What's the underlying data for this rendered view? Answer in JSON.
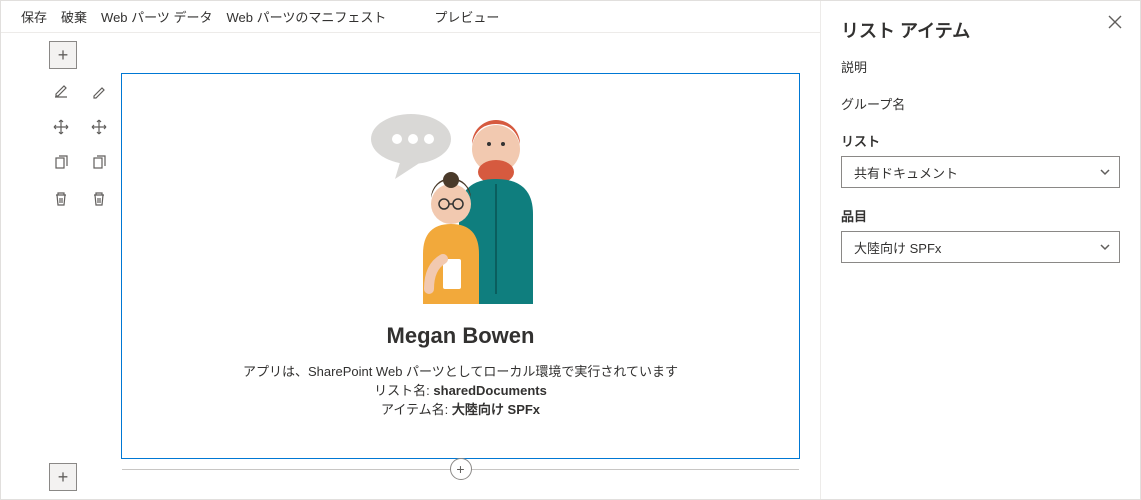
{
  "toolbar": {
    "save": "保存",
    "discard": "破棄",
    "webpart_data": "Web パーツ データ",
    "webpart_manifest": "Web パーツのマニフェスト",
    "preview": "プレビュー"
  },
  "webpart": {
    "title": "Megan Bowen",
    "subtitle": "アプリは、SharePoint Web パーツとしてローカル環境で実行されています",
    "list_label": "リスト名: ",
    "list_value": "sharedDocuments",
    "item_label": "アイテム名: ",
    "item_value": "大陸向け SPFx"
  },
  "panel": {
    "title": "リスト アイテム",
    "description_label": "説明",
    "group_label": "グループ名",
    "list_label": "リスト",
    "list_value": "共有ドキュメント",
    "item_label": "品目",
    "item_value": "大陸向け SPFx"
  }
}
